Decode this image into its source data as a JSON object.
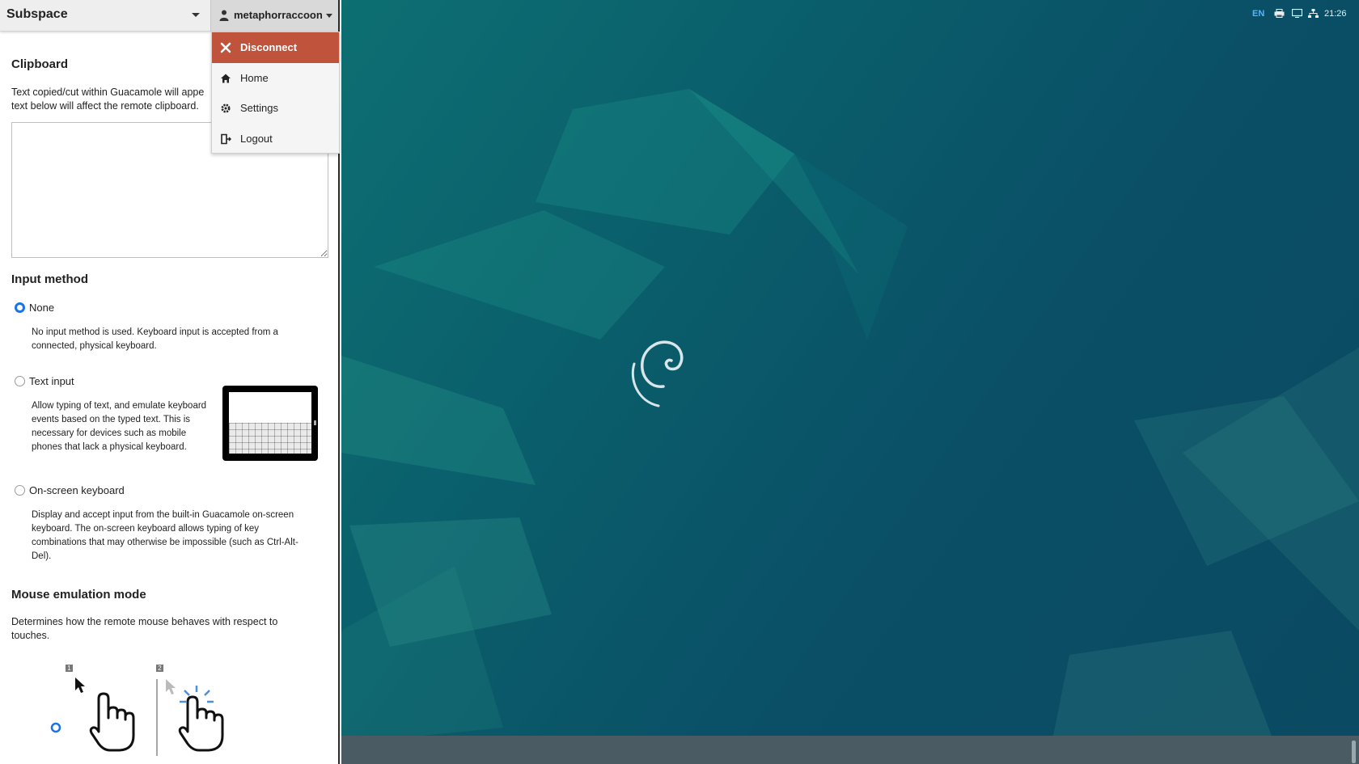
{
  "header": {
    "connection_name": "Subspace",
    "username": "metaphorraccoon"
  },
  "user_menu": {
    "items": [
      {
        "label": "Disconnect",
        "icon": "close-icon"
      },
      {
        "label": "Home",
        "icon": "home-icon"
      },
      {
        "label": "Settings",
        "icon": "gear-icon"
      },
      {
        "label": "Logout",
        "icon": "logout-icon"
      }
    ]
  },
  "clipboard": {
    "title": "Clipboard",
    "description_line1": "Text copied/cut within Guacamole will appe",
    "description_line2": "text below will affect the remote clipboard.",
    "value": ""
  },
  "input_method": {
    "title": "Input method",
    "options": [
      {
        "label": "None",
        "selected": true,
        "desc_lines": [
          "No input method is used. Keyboard input is accepted from a",
          "connected, physical keyboard."
        ]
      },
      {
        "label": "Text input",
        "selected": false,
        "desc_lines": [
          "Allow typing of text, and emulate keyboard",
          "events based on the typed text. This is",
          "necessary for devices such as mobile",
          "phones that lack a physical keyboard."
        ]
      },
      {
        "label": "On-screen keyboard",
        "selected": false,
        "desc_lines": [
          "Display and accept input from the built-in Guacamole on-screen",
          "keyboard. The on-screen keyboard allows typing of key",
          "combinations that may otherwise be impossible (such as Ctrl-Alt-",
          "Del)."
        ]
      }
    ]
  },
  "mouse_emulation": {
    "title": "Mouse emulation mode",
    "description_line1": "Determines how the remote mouse behaves with respect to",
    "description_line2": "touches.",
    "modes": [
      {
        "number": "1",
        "selected": true
      },
      {
        "number": "2",
        "selected": false
      }
    ]
  },
  "taskbar": {
    "language": "EN",
    "clock": "21:26",
    "icons": [
      "printer-icon",
      "display-icon",
      "network-icon"
    ]
  },
  "colors": {
    "disconnect_bg": "#c0533b",
    "radio_accent": "#1a73e8",
    "desktop_bg": "#0a4f66",
    "taskbar_bg": "#4a5b64"
  }
}
